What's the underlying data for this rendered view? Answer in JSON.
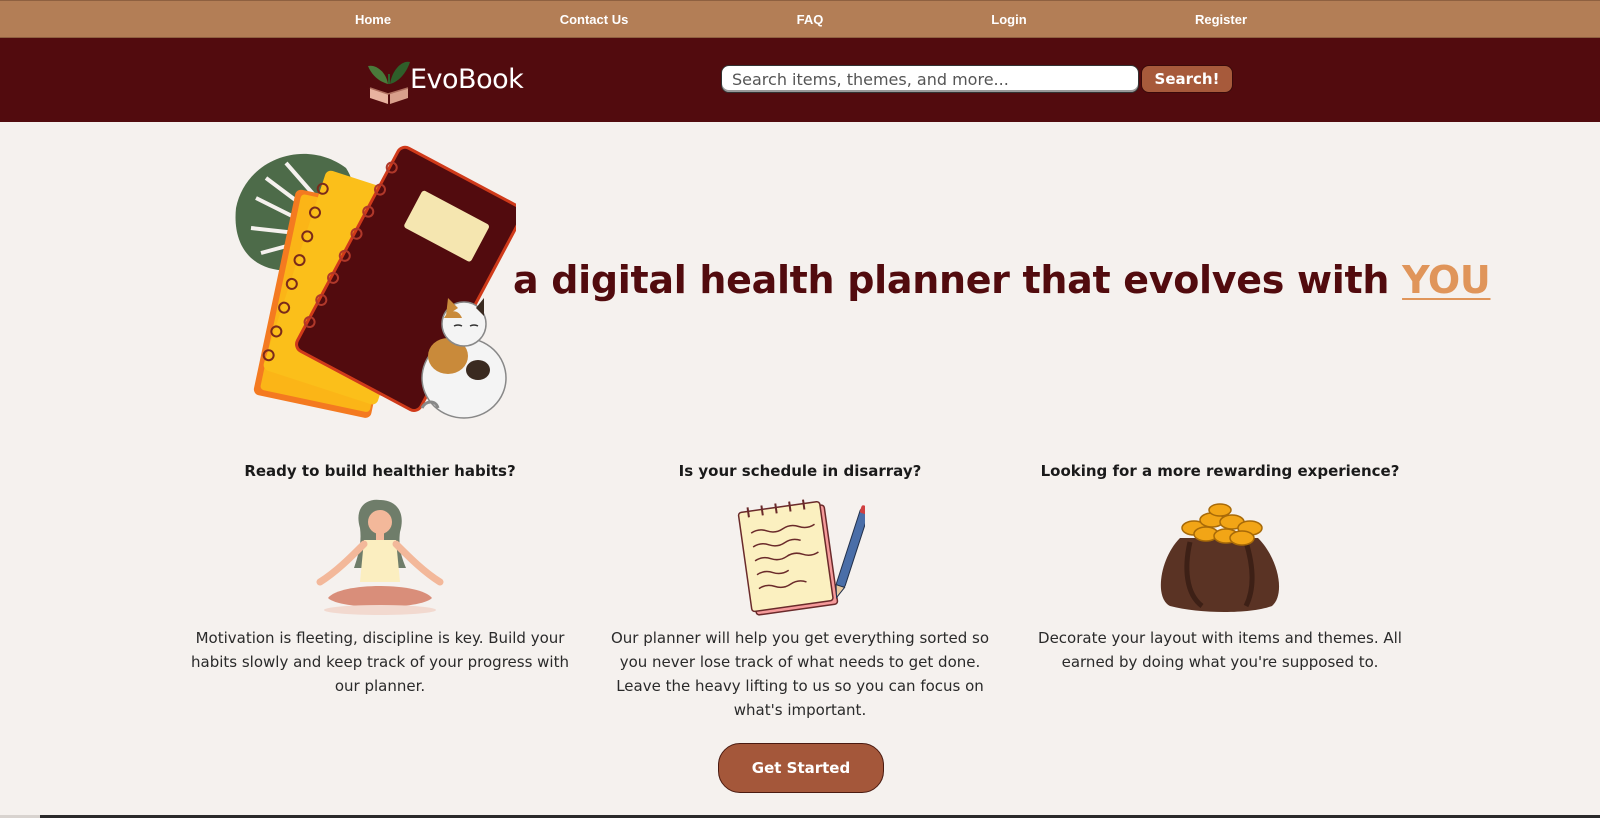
{
  "nav": {
    "items": [
      {
        "label": "Home"
      },
      {
        "label": "Contact Us"
      },
      {
        "label": "FAQ"
      },
      {
        "label": "Login"
      },
      {
        "label": "Register"
      }
    ]
  },
  "header": {
    "brand": "EvoBook",
    "search": {
      "placeholder": "Search items, themes, and more...",
      "value": "",
      "button_label": "Search!"
    }
  },
  "hero": {
    "title": "a digital health planner that evolves with",
    "highlight": "YOU"
  },
  "features": [
    {
      "heading": "Ready to build healthier habits?",
      "icon": "meditation-icon",
      "text": "Motivation is fleeting, discipline is key. Build your habits slowly and keep track of your progress with our planner."
    },
    {
      "heading": "Is your schedule in disarray?",
      "icon": "notepad-icon",
      "text": "Our planner will help you get everything sorted so you never lose track of what needs to get done. Leave the heavy lifting to us so you can focus on what's important."
    },
    {
      "heading": "Looking for a more rewarding experience?",
      "icon": "coin-bag-icon",
      "text": "Decorate your layout with items and themes. All earned by doing what you're supposed to."
    }
  ],
  "cta": {
    "label": "Get Started"
  },
  "colors": {
    "nav_bg": "#b37e56",
    "header_bg": "#520b0e",
    "accent": "#a75a3b",
    "highlight": "#e0955a",
    "page_bg": "#f5f1ee"
  }
}
